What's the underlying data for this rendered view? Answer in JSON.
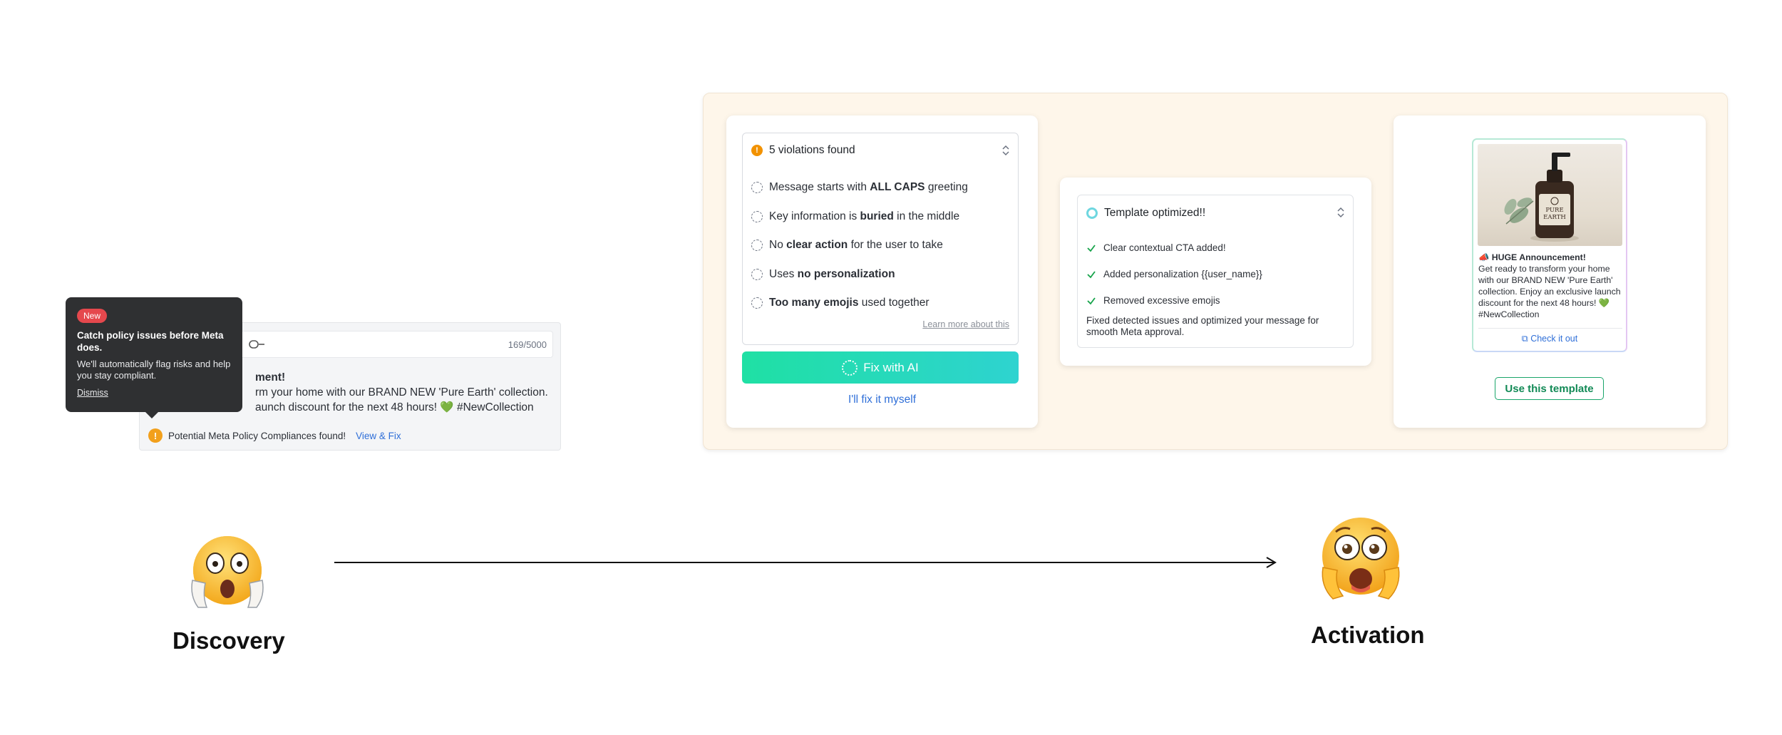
{
  "discovery": {
    "composer": {
      "char_count": "169/5000",
      "headline_fragment": "ment!",
      "line1": "rm your home with our BRAND NEW 'Pure Earth' collection.",
      "line2": "aunch discount for the next 48 hours! 💚 #NewCollection",
      "warning_text": "Potential Meta Policy Compliances found!",
      "warning_link": "View & Fix"
    },
    "tooltip": {
      "badge": "New",
      "title": "Catch policy issues before Meta does.",
      "description": "We'll automatically flag risks and help you stay compliant.",
      "dismiss": "Dismiss"
    },
    "emoji": "😱",
    "label": "Discovery"
  },
  "activation": {
    "violations": {
      "header": "5 violations found",
      "items": [
        {
          "pre": "Message starts with ",
          "bold": "ALL CAPS",
          "post": " greeting"
        },
        {
          "pre": "Key information is ",
          "bold": "buried",
          "post": " in the middle"
        },
        {
          "pre": "No ",
          "bold": "clear action",
          "post": " for the user to take"
        },
        {
          "pre": "Uses ",
          "bold": "no personalization",
          "post": ""
        },
        {
          "pre": "",
          "bold": "Too many emojis",
          "post": " used together"
        }
      ],
      "learn_more": "Learn more about this",
      "fix_ai_label": "Fix with AI",
      "fix_myself_label": "I'll fix it myself"
    },
    "optimized": {
      "header": "Template optimized!!",
      "checks": [
        "Clear contextual CTA added!",
        "Added personalization {{user_name}}",
        "Removed excessive emojis"
      ],
      "summary": "Fixed detected issues and optimized your message for smooth Meta approval."
    },
    "preview": {
      "product_brand": "PURE EARTH",
      "heading": "📣 HUGE Announcement!",
      "body": "Get ready to transform your home with our BRAND NEW 'Pure Earth' collection. Enjoy an exclusive launch discount for the next 48 hours! 💚 #NewCollection",
      "cta": "Check it out",
      "use_template_label": "Use this template"
    },
    "emoji": "😨",
    "label": "Activation"
  },
  "colors": {
    "panel_bg": "#fef6ea",
    "accent_green": "#1fe0a4",
    "accent_teal": "#2ed3d0",
    "link_blue": "#2f6fd8",
    "warning_orange": "#f2a01c",
    "badge_red": "#e5484d"
  }
}
